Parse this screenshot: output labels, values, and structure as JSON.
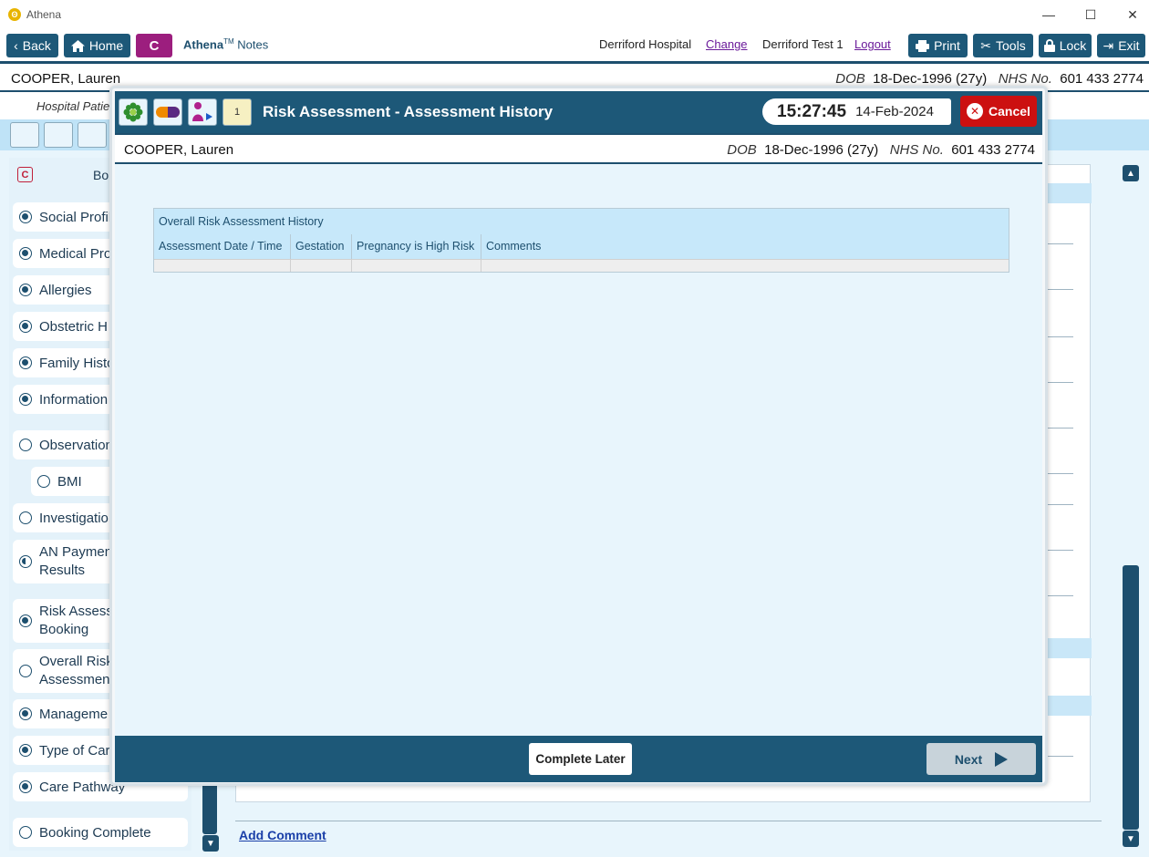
{
  "window": {
    "title": "Athena",
    "app_icon": "athena-logo-icon"
  },
  "toolbar": {
    "back_label": "Back",
    "home_label": "Home",
    "badge_letter": "C",
    "brand_name": "Athena",
    "brand_tm": "TM",
    "brand_suffix": "Notes",
    "hospital": "Derriford Hospital",
    "change_label": "Change",
    "user": "Derriford Test 1",
    "logout_label": "Logout",
    "print_label": "Print",
    "tools_label": "Tools",
    "lock_label": "Lock",
    "exit_label": "Exit"
  },
  "patient": {
    "name": "COOPER, Lauren",
    "dob_label": "DOB",
    "dob": "18-Dec-1996 (27y)",
    "nhs_label": "NHS No.",
    "nhs": "601 433 2774",
    "hospital_patient_label": "Hospital Patie"
  },
  "sidebar": {
    "badge_letter": "C",
    "header_label": "Bo",
    "items": [
      {
        "label": "Social Profil",
        "status": "complete"
      },
      {
        "label": "Medical Pro",
        "status": "complete"
      },
      {
        "label": "Allergies",
        "status": "complete"
      },
      {
        "label": "Obstetric H",
        "status": "complete"
      },
      {
        "label": "Family Histo",
        "status": "complete"
      },
      {
        "label": "Information",
        "status": "complete"
      },
      {
        "label": "Observation",
        "status": "empty"
      },
      {
        "label": "BMI",
        "status": "empty"
      },
      {
        "label": "Investigatio",
        "status": "empty"
      },
      {
        "label": "AN Paymen",
        "label2": "Results",
        "status": "partial"
      },
      {
        "label": "Risk Assess",
        "label2": "Booking",
        "status": "complete"
      },
      {
        "label": "Overall Risk",
        "label2": "Assessment",
        "status": "empty"
      },
      {
        "label": "Manageme",
        "status": "complete"
      },
      {
        "label": "Type of Car",
        "status": "complete"
      },
      {
        "label": "Care Pathway",
        "status": "complete"
      },
      {
        "label": "Booking Complete",
        "status": "empty"
      }
    ]
  },
  "main": {
    "add_comment_label": "Add Comment"
  },
  "modal": {
    "title": "Risk Assessment - Assessment History",
    "time": "15:27:45",
    "date": "14-Feb-2024",
    "cancel_label": "Cancel",
    "patient_name": "COOPER, Lauren",
    "dob_label": "DOB",
    "dob": "18-Dec-1996 (27y)",
    "nhs_label": "NHS No.",
    "nhs": "601 433 2774",
    "header_icons": [
      "flower-icon",
      "pill-icon",
      "mother-baby-icon",
      "calendar-icon"
    ],
    "calendar_day": "1",
    "table": {
      "caption": "Overall Risk Assessment History",
      "columns": [
        "Assessment Date / Time",
        "Gestation",
        "Pregnancy is High Risk",
        "Comments"
      ],
      "rows": []
    },
    "complete_later_label": "Complete Later",
    "next_label": "Next"
  },
  "colors": {
    "primary": "#1d5878",
    "badge": "#9c1e7e",
    "cancel": "#cc1010",
    "body_bg": "#e8f5fc",
    "header_cell_bg": "#c7e8fa"
  }
}
